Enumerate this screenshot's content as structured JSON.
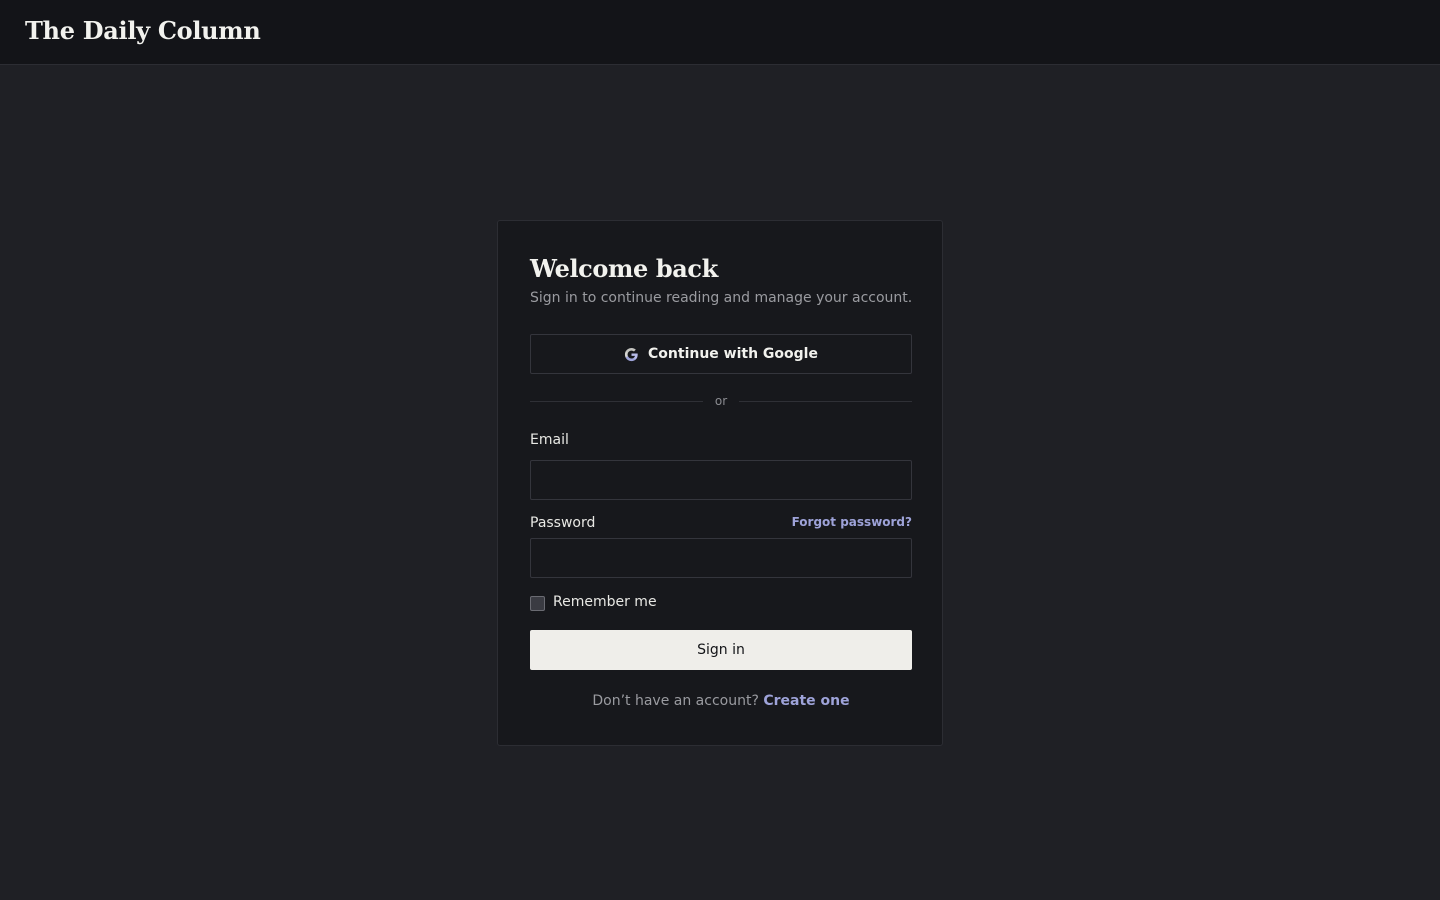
{
  "header": {
    "brand": "The Daily Column"
  },
  "login": {
    "title": "Welcome back",
    "subtitle": "Sign in to continue reading and manage your account.",
    "google_button_label": "Continue with Google",
    "divider_text": "or",
    "email_label": "Email",
    "email_value": "",
    "password_label": "Password",
    "password_value": "",
    "forgot_password_label": "Forgot password?",
    "remember_me_label": "Remember me",
    "remember_me_checked": false,
    "submit_label": "Sign in",
    "signup_prompt": "Don’t have an account?",
    "signup_link_label": "Create one"
  },
  "icons": {
    "google": "google-icon"
  },
  "colors": {
    "page_background": "#1f2025",
    "header_background": "#131418",
    "card_background": "#17181c",
    "accent_link": "#9ea3d9",
    "primary_button": "#efeeea"
  }
}
